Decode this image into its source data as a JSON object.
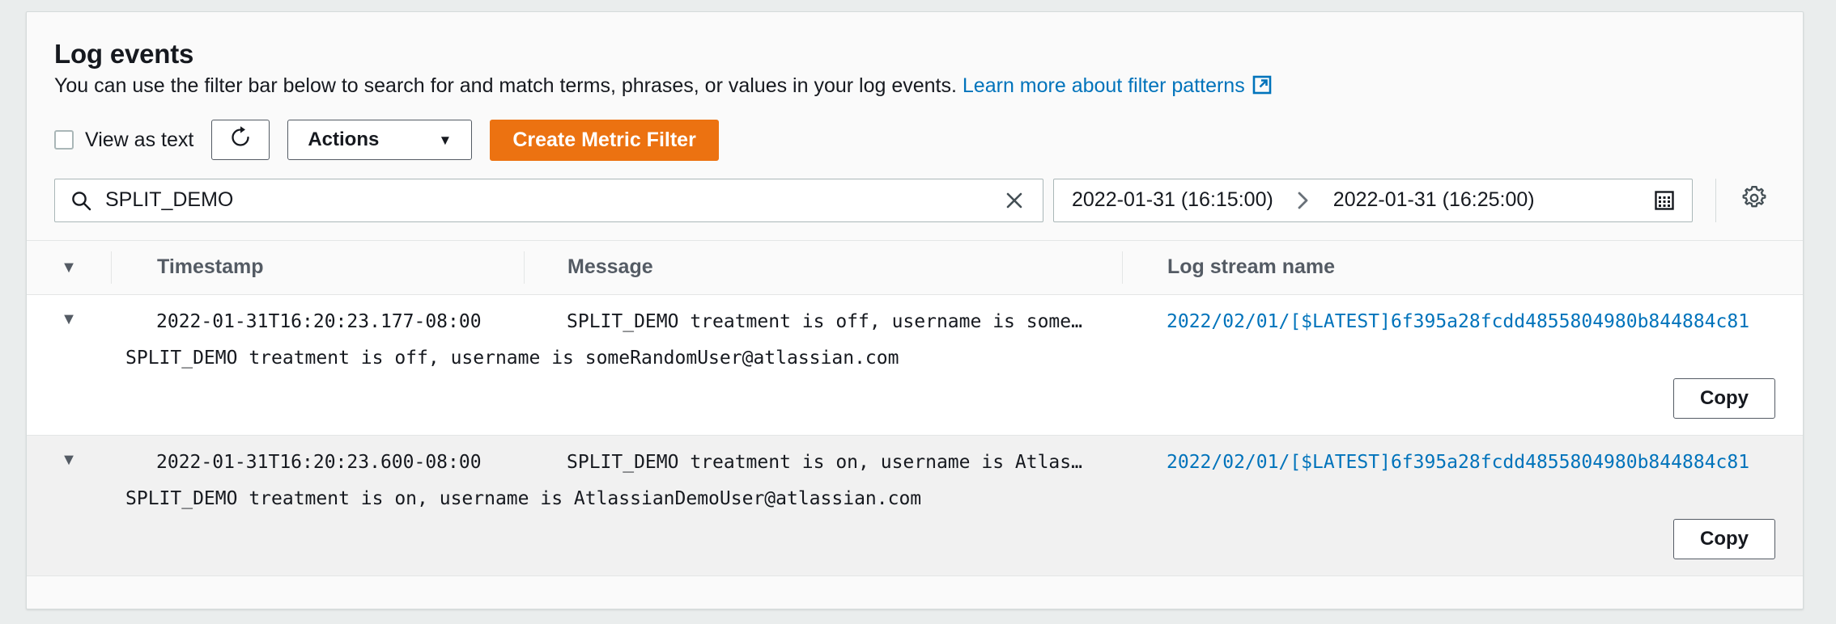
{
  "panel": {
    "title": "Log events",
    "description": "You can use the filter bar below to search for and match terms, phrases, or values in your log events.",
    "learn_more_label": "Learn more about filter patterns",
    "external_link_icon": "external-link-icon"
  },
  "toolbar": {
    "view_as_text_label": "View as text",
    "view_as_text_checked": false,
    "refresh_icon": "refresh-icon",
    "actions_label": "Actions",
    "actions_caret": "▼",
    "create_metric_filter_label": "Create Metric Filter",
    "primary_color": "#ec7211"
  },
  "filter": {
    "search_icon": "search-icon",
    "search_value": "SPLIT_DEMO",
    "search_placeholder": "Filter events",
    "clear_icon": "close-icon",
    "date_start": "2022-01-31 (16:15:00)",
    "date_arrow": "❯",
    "date_end": "2022-01-31 (16:25:00)",
    "calendar_icon": "calendar-icon",
    "settings_icon": "gear-icon"
  },
  "table": {
    "sort_caret": "▼",
    "columns": {
      "timestamp": "Timestamp",
      "message": "Message",
      "log_stream_name": "Log stream name"
    },
    "copy_label": "Copy",
    "rows": [
      {
        "caret": "▼",
        "timestamp": "2022-01-31T16:20:23.177-08:00",
        "message_truncated": "SPLIT_DEMO treatment is off, username is some…",
        "log_stream_name": "2022/02/01/[$LATEST]6f395a28fcdd4855804980b844884c81",
        "message_full": "SPLIT_DEMO treatment is off, username is someRandomUser@atlassian.com"
      },
      {
        "caret": "▼",
        "timestamp": "2022-01-31T16:20:23.600-08:00",
        "message_truncated": "SPLIT_DEMO treatment is on, username is Atlas…",
        "log_stream_name": "2022/02/01/[$LATEST]6f395a28fcdd4855804980b844884c81",
        "message_full": "SPLIT_DEMO treatment is on, username is AtlassianDemoUser@atlassian.com"
      }
    ]
  }
}
